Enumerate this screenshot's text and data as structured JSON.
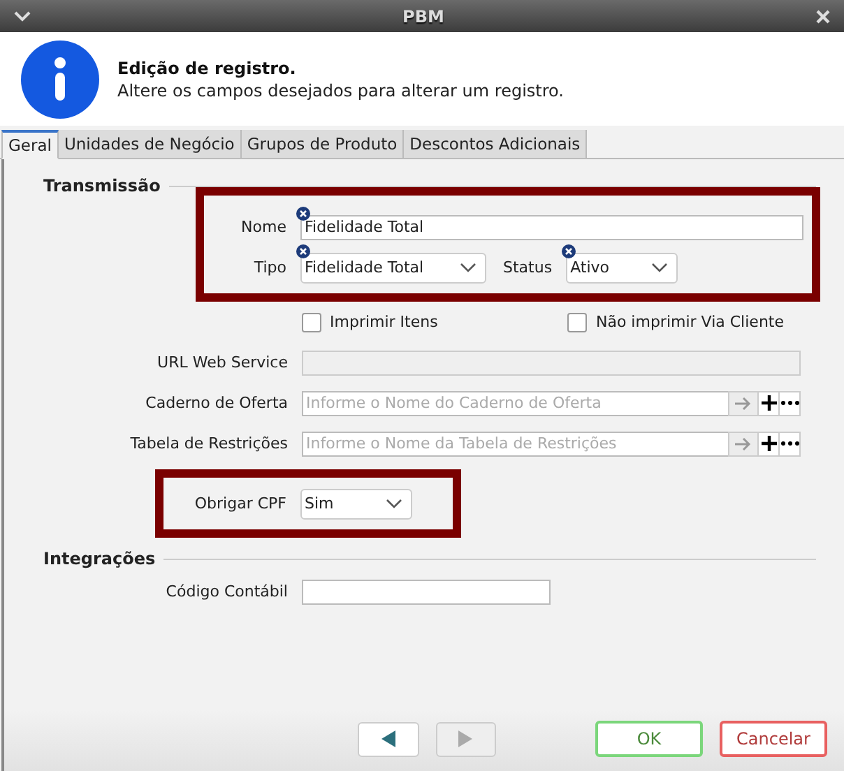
{
  "window": {
    "title": "PBM"
  },
  "header": {
    "title": "Edição de registro.",
    "subtitle": "Altere os campos desejados para alterar um registro."
  },
  "tabs": [
    {
      "label": "Geral",
      "selected": true
    },
    {
      "label": "Unidades de Negócio",
      "selected": false
    },
    {
      "label": "Grupos de Produto",
      "selected": false
    },
    {
      "label": "Descontos Adicionais",
      "selected": false
    }
  ],
  "sections": [
    {
      "title": "Transmissão",
      "groups": [
        {
          "highlighted": true,
          "rows": [
            {
              "kind": "fields",
              "label": "Nome",
              "fields": [
                {
                  "kind": "text",
                  "value": "Fidelidade Total",
                  "clearable": true,
                  "disabled": false
                }
              ]
            },
            {
              "kind": "fields",
              "label": "Tipo",
              "fields": [
                {
                  "kind": "combo",
                  "value": "Fidelidade Total",
                  "clearable": true
                },
                {
                  "kind": "combo",
                  "label": "Status",
                  "value": "Ativo",
                  "clearable": true
                }
              ]
            }
          ]
        },
        {
          "highlighted": false,
          "rows": [
            {
              "kind": "checks",
              "checks": [
                {
                  "label": "Imprimir Itens",
                  "checked": false
                },
                {
                  "label": "Não imprimir Via Cliente",
                  "checked": false
                }
              ]
            },
            {
              "kind": "fields",
              "label": "URL Web Service",
              "fields": [
                {
                  "kind": "text",
                  "clearable": false,
                  "disabled": true
                }
              ]
            },
            {
              "kind": "fields",
              "label": "Caderno de Oferta",
              "fields": [
                {
                  "kind": "lookup",
                  "placeholder": "Informe o Nome do Caderno de Oferta"
                }
              ]
            },
            {
              "kind": "fields",
              "label": "Tabela de Restrições",
              "fields": [
                {
                  "kind": "lookup",
                  "placeholder": "Informe o Nome da Tabela de Restrições"
                }
              ]
            }
          ]
        },
        {
          "highlighted": true,
          "rows": [
            {
              "kind": "fields",
              "label": "Obrigar CPF",
              "fields": [
                {
                  "kind": "combo",
                  "value": "Sim",
                  "clearable": false
                }
              ]
            }
          ]
        }
      ]
    },
    {
      "title": "Integrações",
      "groups": [
        {
          "highlighted": false,
          "rows": [
            {
              "kind": "fields",
              "label": "Código Contábil",
              "fields": [
                {
                  "kind": "text",
                  "clearable": false,
                  "disabled": false,
                  "short": true
                }
              ]
            }
          ]
        }
      ]
    }
  ],
  "footer": {
    "back_enabled": true,
    "forward_enabled": false,
    "ok": "OK",
    "cancel": "Cancelar"
  }
}
